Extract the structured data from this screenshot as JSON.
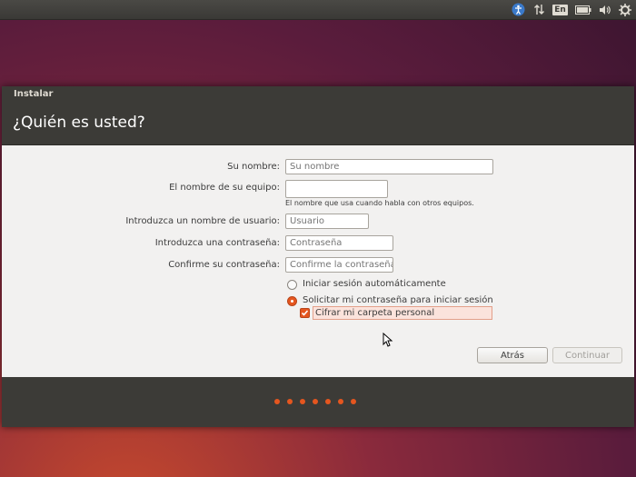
{
  "window": {
    "title": "Instalar",
    "heading": "¿Quién es usted?"
  },
  "tray": {
    "keyboard_layout": "En",
    "icons": [
      "accessibility-icon",
      "network-icon",
      "keyboard-layout-indicator",
      "battery-icon",
      "volume-icon",
      "gear-icon"
    ]
  },
  "form": {
    "name_label": "Su nombre:",
    "name_placeholder": "Su nombre",
    "computer_label": "El nombre de su equipo:",
    "computer_value": "",
    "computer_hint": "El nombre que usa cuando habla con otros equipos.",
    "username_label": "Introduzca un nombre de usuario:",
    "username_placeholder": "Usuario",
    "password_label": "Introduzca una contraseña:",
    "password_placeholder": "Contraseña",
    "confirm_label": "Confirme su contraseña:",
    "confirm_placeholder": "Confirme la contraseña",
    "auto_login_label": "Iniciar sesión automáticamente",
    "auto_login_selected": false,
    "require_password_label": "Solicitar mi contraseña para iniciar sesión",
    "require_password_selected": true,
    "encrypt_label": "Cifrar mi carpeta personal",
    "encrypt_checked": true
  },
  "buttons": {
    "back": "Atrás",
    "continue": "Continuar"
  },
  "progress": {
    "total_steps": 7
  },
  "colors": {
    "accent": "#e5561f",
    "panel": "#3c3b37",
    "content_bg": "#f2f1f0"
  }
}
